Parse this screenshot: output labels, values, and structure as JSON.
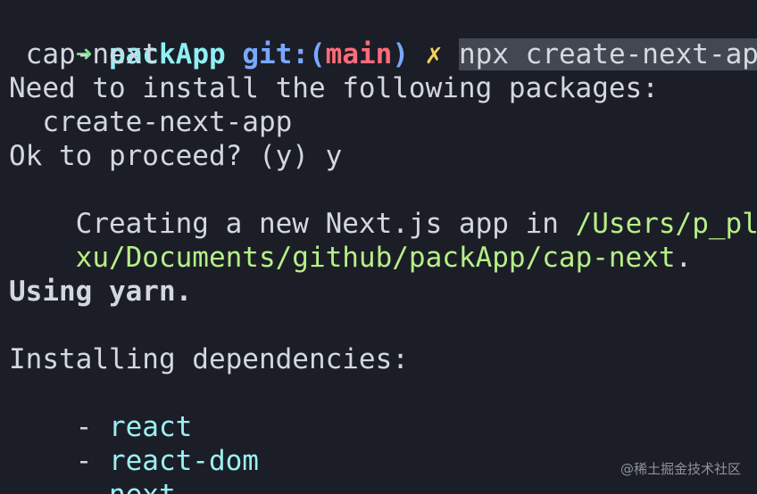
{
  "terminal": {
    "prompt": {
      "arrow": "➜",
      "directory": "packApp",
      "git_label": "git:",
      "branch_open": "(",
      "branch": "main",
      "branch_close": ")",
      "status_symbol": "✗",
      "command_first_line": "npx create-next-app",
      "command_second_line": " cap-next"
    },
    "lines": {
      "need_install": "Need to install the following packages:",
      "package_name": "  create-next-app",
      "proceed": "Ok to proceed? (y) y",
      "creating_prefix": "Creating a new Next.js app in ",
      "path_first": "/Users/p_plei",
      "path_second": "xu/Documents/github/packApp/cap-next",
      "period": ".",
      "using_yarn": "Using yarn.",
      "installing": "Installing dependencies:"
    },
    "dependencies": [
      "react",
      "react-dom",
      "next"
    ],
    "dep_prefix": "- "
  },
  "watermark": "@稀土掘金技术社区",
  "colors": {
    "background": "#1b1e27",
    "text": "#d3d7df",
    "arrow": "#7ee08b",
    "directory": "#8ff0f5",
    "git": "#79a8ff",
    "branch": "#ff6b7a",
    "status": "#f0d35d",
    "path": "#b7ef86",
    "dependency": "#9bf0f3",
    "command_highlight": "#424751"
  }
}
